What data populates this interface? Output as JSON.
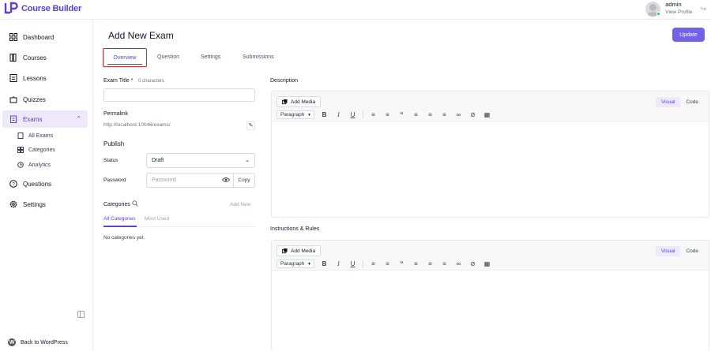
{
  "app": {
    "brand": "Course Builder"
  },
  "user": {
    "name": "admin",
    "link": "View Profile"
  },
  "sidebar": {
    "items": [
      {
        "label": "Dashboard"
      },
      {
        "label": "Courses"
      },
      {
        "label": "Lessons"
      },
      {
        "label": "Quizzes"
      },
      {
        "label": "Exams"
      },
      {
        "label": "Questions"
      },
      {
        "label": "Settings"
      }
    ],
    "exam_sub": [
      {
        "label": "All Exams"
      },
      {
        "label": "Categories"
      },
      {
        "label": "Analytics"
      }
    ],
    "back": "Back to WordPress"
  },
  "page": {
    "title": "Add New Exam",
    "update": "Update",
    "tabs": [
      "Overview",
      "Question",
      "Settings",
      "Submissions"
    ]
  },
  "form": {
    "exam_title_label": "Exam Title",
    "required_mark": "*",
    "char_count": "0 characters",
    "permalink_label": "Permalink",
    "permalink_value": "http://localhost:10046/exams/",
    "publish_label": "Publish",
    "status_label": "Status",
    "status_value": "Draft",
    "password_label": "Password",
    "password_placeholder": "Password",
    "copy_label": "Copy",
    "categories_label": "Categories",
    "add_new": "Add New",
    "cat_tabs": [
      "All Categories",
      "Most Used"
    ],
    "no_categories": "No categories yet."
  },
  "editors": {
    "description_label": "Description",
    "instructions_label": "Instructions & Rules",
    "add_media": "Add Media",
    "visual": "Visual",
    "code": "Code",
    "paragraph": "Paragraph"
  },
  "colors": {
    "accent": "#5b3fd6",
    "button": "#7262e8",
    "highlight_border": "#e02424"
  }
}
